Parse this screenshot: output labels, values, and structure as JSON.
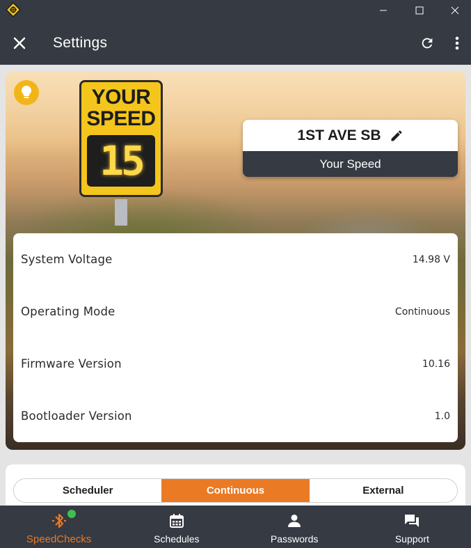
{
  "header": {
    "title": "Settings"
  },
  "device": {
    "sign_text": "YOUR SPEED",
    "sign_number": "15",
    "name": "1ST AVE SB",
    "display_mode": "Your Speed"
  },
  "info": [
    {
      "label": "System Voltage",
      "value": "14.98 V"
    },
    {
      "label": "Operating Mode",
      "value": "Continuous"
    },
    {
      "label": "Firmware Version",
      "value": "10.16"
    },
    {
      "label": "Bootloader Version",
      "value": "1.0"
    }
  ],
  "modes": [
    {
      "label": "Scheduler",
      "active": false
    },
    {
      "label": "Continuous",
      "active": true
    },
    {
      "label": "External",
      "active": false
    }
  ],
  "nav": [
    {
      "label": "SpeedChecks",
      "icon": "bluetooth-icon",
      "active": true
    },
    {
      "label": "Schedules",
      "icon": "calendar-icon",
      "active": false
    },
    {
      "label": "Passwords",
      "icon": "person-icon",
      "active": false
    },
    {
      "label": "Support",
      "icon": "chat-icon",
      "active": false
    }
  ],
  "colors": {
    "accent": "#ea7a24",
    "dark": "#353a43",
    "status_dot": "#3fbf4f",
    "bulb": "#f2b518"
  }
}
